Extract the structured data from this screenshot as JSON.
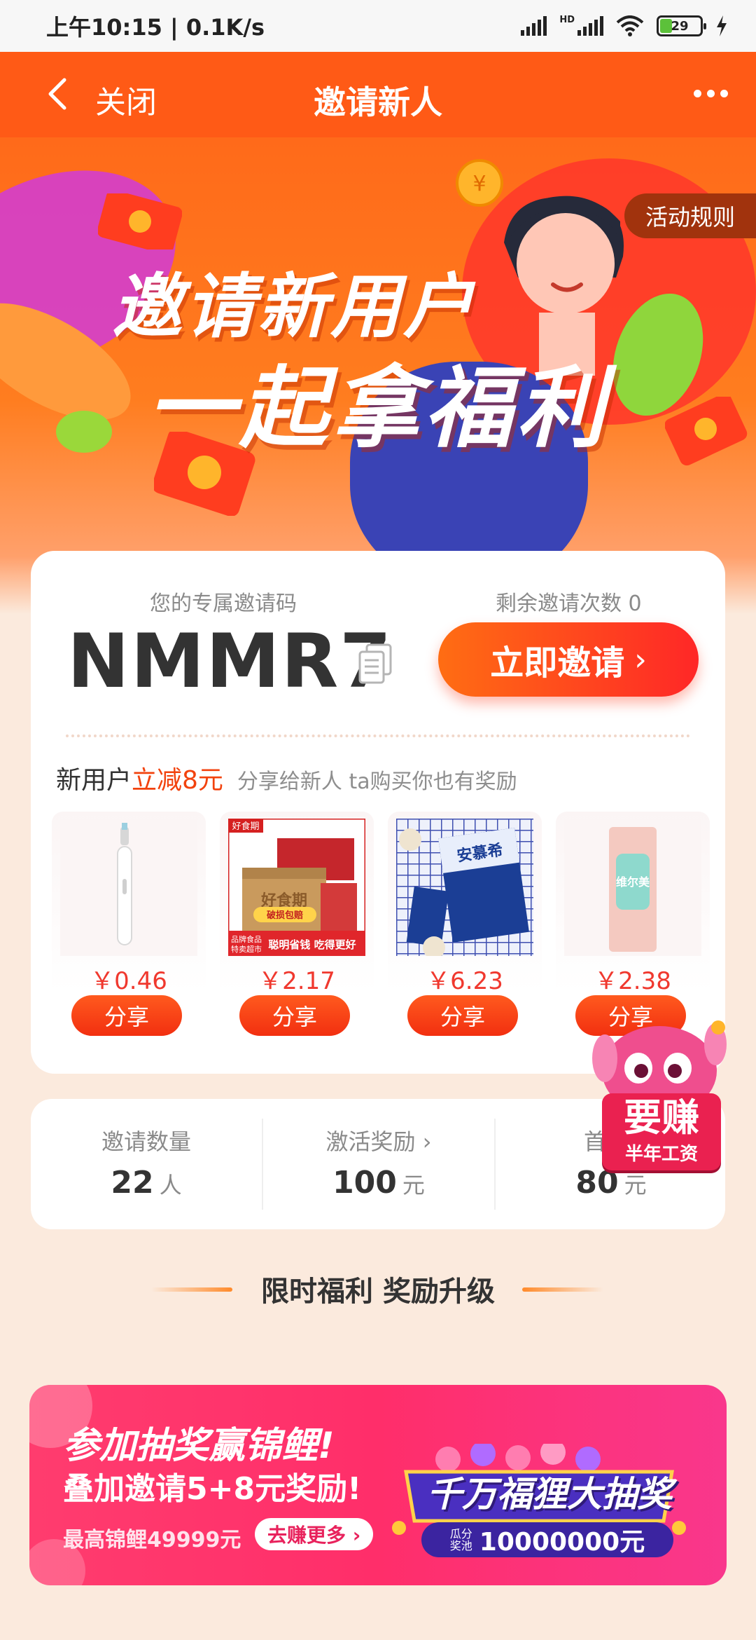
{
  "status_bar": {
    "time_speed": "上午10:15 | 0.1K/s",
    "hd": "HD",
    "battery": "29"
  },
  "nav": {
    "close_label": "关闭",
    "title": "邀请新人"
  },
  "banner": {
    "rules_label": "活动规则",
    "headline_line1": "邀请新用户",
    "headline_line2": "一起拿福利"
  },
  "invite": {
    "code_label": "您的专属邀请码",
    "code": "NMMR7",
    "remaining_label": "剩余邀请次数 0",
    "invite_button": "立即邀请",
    "promo_prefix": "新用户",
    "promo_highlight": "立减8元",
    "promo_sub": "分享给新人 ta购买你也有奖励",
    "products": [
      {
        "price": "￥0.46",
        "share": "分享",
        "icon": "toothbrush"
      },
      {
        "price": "￥2.17",
        "share": "分享",
        "icon": "snack-box",
        "brand": "好食期",
        "tag_text": "破损包赔",
        "tag2_left": "品牌食品\n特卖超市",
        "tag2_right": "聪明省钱 吃得更好",
        "box_text": "好食期"
      },
      {
        "price": "￥6.23",
        "share": "分享",
        "icon": "milk-box",
        "brand": "安慕希"
      },
      {
        "price": "￥2.38",
        "share": "分享",
        "icon": "tissue-pack",
        "brand": "维尔美"
      }
    ]
  },
  "stats": {
    "items": [
      {
        "label": "邀请数量",
        "value": "22",
        "unit": "人"
      },
      {
        "label": "激活奖励",
        "value": "100",
        "unit": "元",
        "chevron": "›"
      },
      {
        "label": "首单",
        "value": "80",
        "unit": "元"
      }
    ]
  },
  "mascot": {
    "big": "要赚",
    "small": "半年工资"
  },
  "section": {
    "title": "限时福利 奖励升级"
  },
  "lottery": {
    "line1": "参加抽奖赢锦鲤!",
    "line2": "叠加邀请5+8元奖励!",
    "line3": "最高锦鲤49999元",
    "button": "去赚更多 ›",
    "badge_title": "千万福狸大抽奖",
    "badge_tiny": "瓜分\n奖池",
    "badge_amount": "10000000元"
  },
  "colors": {
    "nav_bg": "#ff5a16",
    "accent_red": "#f0382e",
    "page_bg": "#fbeadd"
  }
}
